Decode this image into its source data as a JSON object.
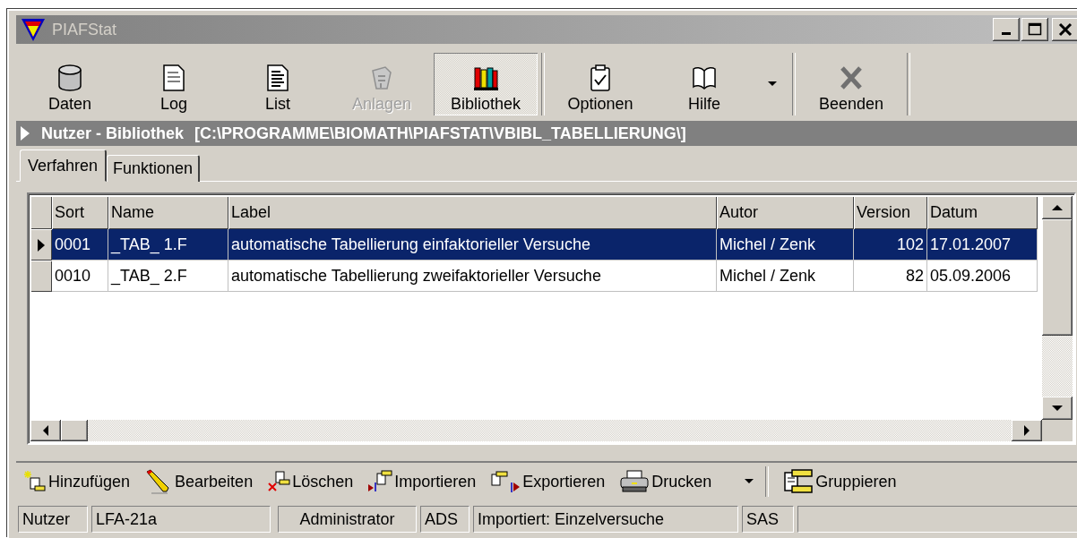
{
  "window": {
    "title": "PIAFStat"
  },
  "toolbar": [
    {
      "kind": "button",
      "label": "Daten",
      "disabled": false,
      "selected": false
    },
    {
      "kind": "button",
      "label": "Log",
      "disabled": false,
      "selected": false
    },
    {
      "kind": "button",
      "label": "List",
      "disabled": false,
      "selected": false
    },
    {
      "kind": "button",
      "label": "Anlagen",
      "disabled": true,
      "selected": false
    },
    {
      "kind": "button",
      "label": "Bibliothek",
      "disabled": false,
      "selected": true
    },
    {
      "kind": "separator"
    },
    {
      "kind": "button",
      "label": "Optionen",
      "disabled": false,
      "selected": false
    },
    {
      "kind": "button",
      "label": "Hilfe",
      "disabled": false,
      "selected": false
    },
    {
      "kind": "dropdown"
    },
    {
      "kind": "separator"
    },
    {
      "kind": "button",
      "label": "Beenden",
      "disabled": false,
      "selected": false
    },
    {
      "kind": "separator"
    }
  ],
  "path_bar": {
    "title": "Nutzer - Bibliothek",
    "path": "[C:\\PROGRAMME\\BIOMATH\\PIAFSTAT\\VBIBL_TABELLIERUNG\\]"
  },
  "tabs": [
    {
      "label": "Verfahren",
      "selected": true
    },
    {
      "label": "Funktionen",
      "selected": false
    }
  ],
  "table": {
    "columns": [
      "Sort",
      "Name",
      "Label",
      "Autor",
      "Version",
      "Datum"
    ],
    "rows": [
      {
        "selected": true,
        "cells": [
          "0001",
          "_TAB_ 1.F",
          "automatische Tabellierung einfaktorieller Versuche",
          "Michel / Zenk",
          "102",
          "17.01.2007"
        ]
      },
      {
        "selected": false,
        "cells": [
          "0010",
          "_TAB_ 2.F",
          "automatische Tabellierung zweifaktorieller Versuche",
          "Michel / Zenk",
          "82",
          "05.09.2006"
        ]
      }
    ]
  },
  "bottom_toolbar": [
    {
      "kind": "button",
      "label": "Hinzufügen"
    },
    {
      "kind": "button",
      "label": "Bearbeiten"
    },
    {
      "kind": "button",
      "label": "Löschen"
    },
    {
      "kind": "button",
      "label": "Importieren"
    },
    {
      "kind": "button",
      "label": "Exportieren"
    },
    {
      "kind": "button",
      "label": "Drucken"
    },
    {
      "kind": "dropdown"
    },
    {
      "kind": "separator"
    },
    {
      "kind": "button",
      "label": "Gruppieren"
    }
  ],
  "status_bar": [
    "Nutzer",
    "LFA-21a",
    "Administrator",
    "ADS",
    "Importiert: Einzelversuche",
    "SAS"
  ]
}
